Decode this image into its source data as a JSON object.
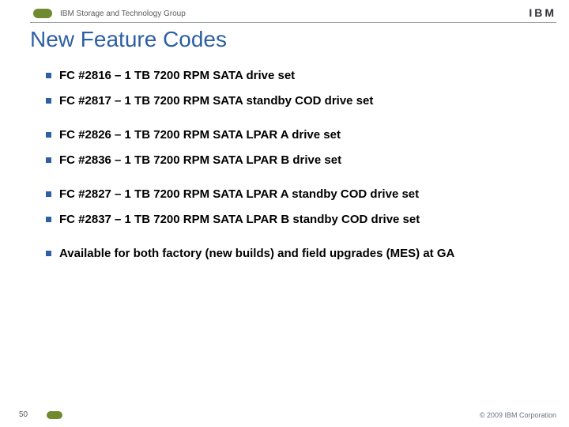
{
  "header": {
    "group": "IBM Storage and Technology Group",
    "logo": "IBM"
  },
  "title": "New Feature Codes",
  "groups": [
    [
      "FC #2816 – 1 TB 7200 RPM SATA drive set",
      "FC #2817 – 1 TB 7200 RPM SATA standby COD drive set"
    ],
    [
      "FC #2826 – 1 TB 7200 RPM SATA LPAR A drive set",
      "FC #2836 – 1 TB 7200 RPM SATA LPAR B drive set"
    ],
    [
      "FC #2827 – 1 TB 7200 RPM SATA LPAR A standby COD drive set",
      "FC #2837 – 1 TB 7200 RPM SATA LPAR B standby COD drive set"
    ],
    [
      "Available for both factory (new builds) and field upgrades (MES) at GA"
    ]
  ],
  "footer": {
    "page": "50",
    "copyright": "© 2009 IBM Corporation"
  }
}
